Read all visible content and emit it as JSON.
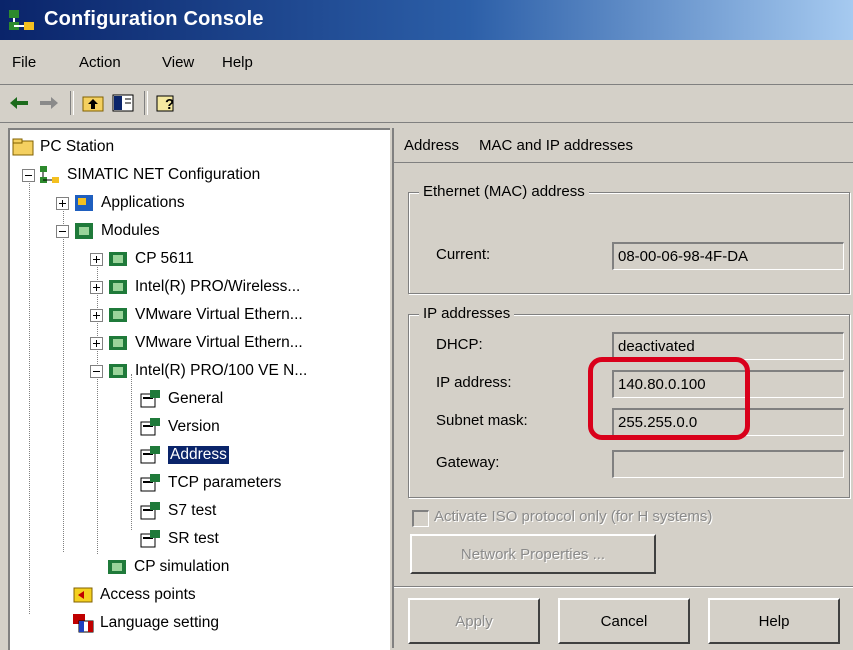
{
  "window": {
    "title": "Configuration Console"
  },
  "menu": [
    "File",
    "Action",
    "View",
    "Help"
  ],
  "toolbar": {
    "back_icon": "back-arrow-icon",
    "forward_icon": "forward-arrow-icon",
    "up_icon": "up-folder-icon",
    "show_hide_icon": "show-hide-tree-icon",
    "help_icon": "help-icon"
  },
  "tree": {
    "root": "PC Station",
    "items": [
      "SIMATIC NET Configuration",
      "Applications",
      "Modules",
      "CP 5611",
      "Intel(R) PRO/Wireless...",
      "VMware Virtual Ethern...",
      "VMware Virtual Ethern...",
      "Intel(R) PRO/100 VE N...",
      "General",
      "Version",
      "Address",
      "TCP parameters",
      "S7 test",
      "SR test",
      "CP simulation",
      "Access points",
      "Language setting"
    ],
    "selected": "Address"
  },
  "right": {
    "header_left": "Address",
    "header_right": "MAC and IP addresses",
    "mac_group": "Ethernet (MAC) address",
    "current_label": "Current:",
    "current_value": "08-00-06-98-4F-DA",
    "ip_group": "IP addresses",
    "dhcp_label": "DHCP:",
    "dhcp_value": "deactivated",
    "ip_label": "IP address:",
    "ip_value": "140.80.0.100",
    "subnet_label": "Subnet mask:",
    "subnet_value": "255.255.0.0",
    "gateway_label": "Gateway:",
    "gateway_value": "",
    "iso_checkbox_label": "Activate ISO protocol only (for H systems)",
    "network_properties_button": "Network Properties ...",
    "apply_button": "Apply",
    "cancel_button": "Cancel",
    "help_button": "Help"
  },
  "colors": {
    "highlight": "#d9001b",
    "selection": "#0a246a",
    "titlebar": "#0a246a"
  }
}
